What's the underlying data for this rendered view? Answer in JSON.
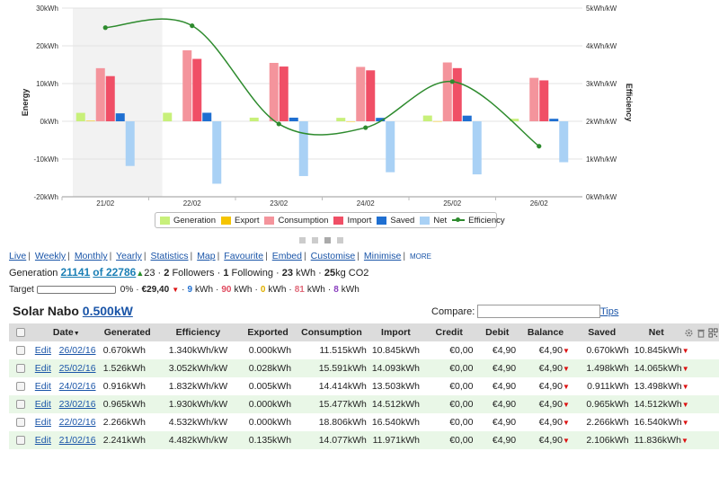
{
  "chart_data": {
    "type": "bar",
    "categories": [
      "21/02",
      "22/02",
      "23/02",
      "24/02",
      "25/02",
      "26/02"
    ],
    "left_axis": {
      "label": "Energy",
      "min": -20,
      "max": 30,
      "ticks": [
        30,
        20,
        10,
        0,
        -10,
        -20
      ],
      "tick_labels": [
        "30kWh",
        "20kWh",
        "10kWh",
        "0kWh",
        "-10kWh",
        "-20kWh"
      ]
    },
    "right_axis": {
      "label": "Efficiency",
      "min": 0,
      "max": 5,
      "ticks": [
        5,
        4,
        3,
        2,
        1,
        0
      ],
      "tick_labels": [
        "5kWh/kW",
        "4kWh/kW",
        "3kWh/kW",
        "2kWh/kW",
        "1kWh/kW",
        "0kWh/kW"
      ]
    },
    "series": [
      {
        "name": "Generation",
        "color": "#c8f07a",
        "values": [
          2.241,
          2.266,
          0.965,
          0.916,
          1.526,
          0.67
        ]
      },
      {
        "name": "Export",
        "color": "#f5c400",
        "values": [
          0.135,
          0.0,
          0.0,
          0.005,
          0.028,
          0.0
        ]
      },
      {
        "name": "Consumption",
        "color": "#f4949c",
        "values": [
          14.077,
          18.806,
          15.477,
          14.414,
          15.591,
          11.515
        ]
      },
      {
        "name": "Import",
        "color": "#f04f66",
        "values": [
          11.971,
          16.54,
          14.512,
          13.503,
          14.093,
          10.845
        ]
      },
      {
        "name": "Saved",
        "color": "#1f6fd1",
        "values": [
          2.106,
          2.266,
          0.965,
          0.911,
          1.498,
          0.67
        ]
      },
      {
        "name": "Net",
        "color": "#a9d1f5",
        "values": [
          -11.836,
          -16.54,
          -14.512,
          -13.498,
          -14.065,
          -10.845
        ]
      },
      {
        "name": "Efficiency",
        "color": "#2e8b2e",
        "type": "line",
        "axis": "right",
        "values": [
          4.482,
          4.532,
          1.93,
          1.832,
          3.052,
          1.34
        ]
      }
    ],
    "grid": true,
    "legend_position": "bottom"
  },
  "legend": [
    {
      "label": "Generation",
      "color": "#c8f07a"
    },
    {
      "label": "Export",
      "color": "#f5c400"
    },
    {
      "label": "Consumption",
      "color": "#f4949c"
    },
    {
      "label": "Import",
      "color": "#f04f66"
    },
    {
      "label": "Saved",
      "color": "#1f6fd1"
    },
    {
      "label": "Net",
      "color": "#a9d1f5"
    },
    {
      "label": "Efficiency",
      "color": "#2e8b2e",
      "line": true
    }
  ],
  "nav": {
    "live": "Live",
    "weekly": "Weekly",
    "monthly": "Monthly",
    "yearly": "Yearly",
    "statistics": "Statistics",
    "map": "Map",
    "favourite": "Favourite",
    "embed": "Embed",
    "customise": "Customise",
    "minimise": "Minimise",
    "more": "MORE"
  },
  "generation": {
    "label": "Generation",
    "rank": "21141",
    "of_text": "of 22786",
    "up_value": "23",
    "followers_count": "2",
    "followers_label": "Followers",
    "following_count": "1",
    "following_label": "Following",
    "kwh_value": "23",
    "kwh_unit": "kWh",
    "co2_value": "25",
    "co2_unit": "kg CO2"
  },
  "target": {
    "label": "Target",
    "progress": 0,
    "percent": "0%",
    "money": "€29,40",
    "blue_value": "9",
    "red_value": "90",
    "yellow_value": "0",
    "pink_value": "81",
    "purple_value": "8",
    "unit": "kWh"
  },
  "system": {
    "name": "Solar Nabo",
    "size": "0.500kW"
  },
  "compare": {
    "label": "Compare:",
    "value": "",
    "tips": "Tips"
  },
  "table": {
    "headers": {
      "date": "Date",
      "generated": "Generated",
      "efficiency": "Efficiency",
      "exported": "Exported",
      "consumption": "Consumption",
      "import": "Import",
      "credit": "Credit",
      "debit": "Debit",
      "balance": "Balance",
      "saved": "Saved",
      "net": "Net"
    },
    "edit_label": "Edit",
    "rows": [
      {
        "date": "26/02/16",
        "generated": "0.670kWh",
        "efficiency": "1.340kWh/kW",
        "exported": "0.000kWh",
        "consumption": "11.515kWh",
        "import": "10.845kWh",
        "credit": "€0,00",
        "debit": "€4,90",
        "balance": "€4,90",
        "saved": "0.670kWh",
        "net": "10.845kWh"
      },
      {
        "date": "25/02/16",
        "generated": "1.526kWh",
        "efficiency": "3.052kWh/kW",
        "exported": "0.028kWh",
        "consumption": "15.591kWh",
        "import": "14.093kWh",
        "credit": "€0,00",
        "debit": "€4,90",
        "balance": "€4,90",
        "saved": "1.498kWh",
        "net": "14.065kWh"
      },
      {
        "date": "24/02/16",
        "generated": "0.916kWh",
        "efficiency": "1.832kWh/kW",
        "exported": "0.005kWh",
        "consumption": "14.414kWh",
        "import": "13.503kWh",
        "credit": "€0,00",
        "debit": "€4,90",
        "balance": "€4,90",
        "saved": "0.911kWh",
        "net": "13.498kWh"
      },
      {
        "date": "23/02/16",
        "generated": "0.965kWh",
        "efficiency": "1.930kWh/kW",
        "exported": "0.000kWh",
        "consumption": "15.477kWh",
        "import": "14.512kWh",
        "credit": "€0,00",
        "debit": "€4,90",
        "balance": "€4,90",
        "saved": "0.965kWh",
        "net": "14.512kWh"
      },
      {
        "date": "22/02/16",
        "generated": "2.266kWh",
        "efficiency": "4.532kWh/kW",
        "exported": "0.000kWh",
        "consumption": "18.806kWh",
        "import": "16.540kWh",
        "credit": "€0,00",
        "debit": "€4,90",
        "balance": "€4,90",
        "saved": "2.266kWh",
        "net": "16.540kWh"
      },
      {
        "date": "21/02/16",
        "generated": "2.241kWh",
        "efficiency": "4.482kWh/kW",
        "exported": "0.135kWh",
        "consumption": "14.077kWh",
        "import": "11.971kWh",
        "credit": "€0,00",
        "debit": "€4,90",
        "balance": "€4,90",
        "saved": "2.106kWh",
        "net": "11.836kWh"
      }
    ]
  }
}
